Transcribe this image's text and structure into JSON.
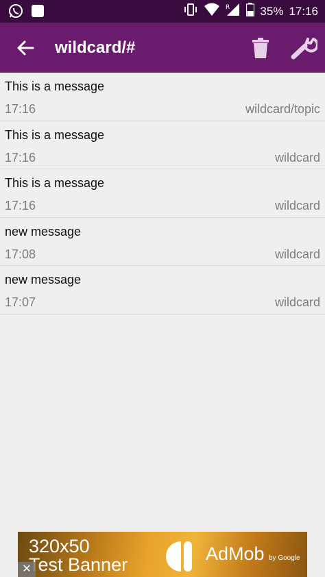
{
  "status_bar": {
    "battery": "35%",
    "time": "17:16",
    "icons": [
      "whatsapp-icon",
      "notification-square-icon",
      "vibrate-icon",
      "wifi-icon",
      "signal-roaming-icon",
      "battery-icon"
    ],
    "roaming_label": "R"
  },
  "app_bar": {
    "title": "wildcard/#",
    "icons": [
      "arrow-back-icon",
      "trash-icon",
      "wrench-icon"
    ]
  },
  "messages": [
    {
      "text": "This is a message",
      "time": "17:16",
      "topic": "wildcard/topic"
    },
    {
      "text": "This is a message",
      "time": "17:16",
      "topic": "wildcard"
    },
    {
      "text": "This is a message",
      "time": "17:16",
      "topic": "wildcard"
    },
    {
      "text": "new message",
      "time": "17:08",
      "topic": "wildcard"
    },
    {
      "text": "new message",
      "time": "17:07",
      "topic": "wildcard"
    }
  ],
  "ad": {
    "line1": "320x50",
    "line2": "Test Banner",
    "brand": "AdMob",
    "sub": "by Google",
    "close": "✕"
  },
  "colors": {
    "status_bar": "#3a0b3e",
    "app_bar": "#6a1b6e",
    "background": "#efefef",
    "divider": "#d6d6d6",
    "secondary_text": "#7d7d7d"
  }
}
